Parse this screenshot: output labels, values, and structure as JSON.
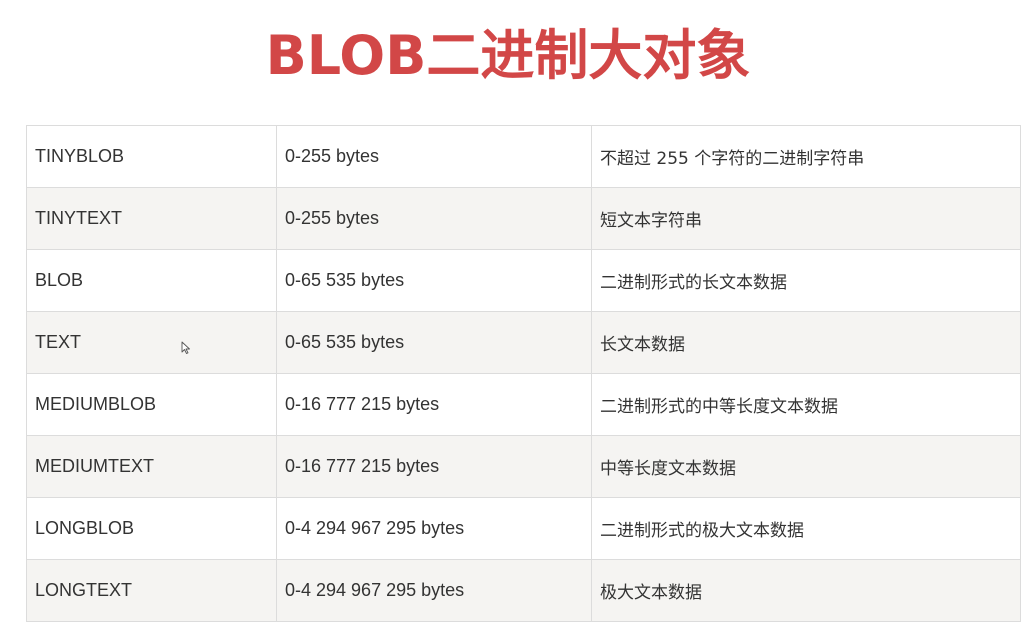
{
  "title": "BLOB二进制大对象",
  "rows": [
    {
      "type": "TINYBLOB",
      "size": "0-255 bytes",
      "description": "不超过 255 个字符的二进制字符串"
    },
    {
      "type": "TINYTEXT",
      "size": "0-255 bytes",
      "description": "短文本字符串"
    },
    {
      "type": "BLOB",
      "size": "0-65 535 bytes",
      "description": "二进制形式的长文本数据"
    },
    {
      "type": "TEXT",
      "size": "0-65 535 bytes",
      "description": "长文本数据"
    },
    {
      "type": "MEDIUMBLOB",
      "size": "0-16 777 215 bytes",
      "description": "二进制形式的中等长度文本数据"
    },
    {
      "type": "MEDIUMTEXT",
      "size": "0-16 777 215 bytes",
      "description": "中等长度文本数据"
    },
    {
      "type": "LONGBLOB",
      "size": "0-4 294 967 295 bytes",
      "description": "二进制形式的极大文本数据"
    },
    {
      "type": "LONGTEXT",
      "size": "0-4 294 967 295 bytes",
      "description": "极大文本数据"
    }
  ],
  "colors": {
    "title": "#d24747",
    "row_alt": "#f5f4f2",
    "border": "#dcdcdc",
    "text": "#333333"
  },
  "icons": {
    "cursor": "mouse-pointer-icon"
  }
}
